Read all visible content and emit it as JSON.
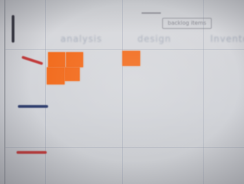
{
  "photo": {
    "subject": "whiteboard with sticky notes"
  },
  "board": {
    "column_headers": [
      "analysis",
      "design",
      "Inventory"
    ],
    "label_box_text": "backlog items"
  },
  "colors": {
    "sticky_note": "#f26a1b",
    "marker_dark": "#2f2f3a",
    "marker_red": "#c23a3a",
    "marker_blue": "#2f3e6e"
  }
}
